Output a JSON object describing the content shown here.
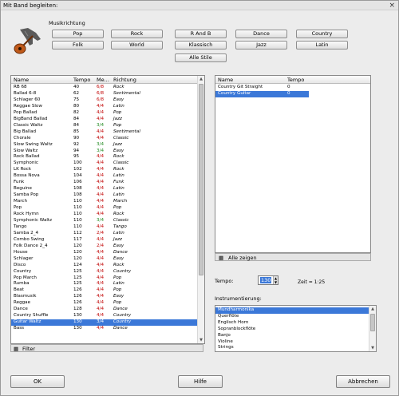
{
  "window": {
    "title": "Mit Band begleiten:",
    "close": "×"
  },
  "styles": {
    "group_label": "Musikrichtung",
    "buttons": [
      "Pop",
      "Rock",
      "R And B",
      "Dance",
      "Country",
      "Folk",
      "World",
      "Klassisch",
      "Jazz",
      "Latin",
      "Alle Stile"
    ]
  },
  "left_table": {
    "headers": [
      "Name",
      "Tempo",
      "Me...",
      "Richtung"
    ],
    "rows": [
      [
        "RB 68",
        "40",
        "6/8",
        "Rock"
      ],
      [
        "Ballad 6-8",
        "62",
        "6/8",
        "Sentimental"
      ],
      [
        "Schlager 60",
        "75",
        "6/8",
        "Easy"
      ],
      [
        "Reggae Slow",
        "80",
        "4/4",
        "Latin"
      ],
      [
        "Pop Ballad",
        "82",
        "4/4",
        "Pop"
      ],
      [
        "BigBand Ballad",
        "84",
        "4/4",
        "Jazz"
      ],
      [
        "Classic Waltz",
        "84",
        "3/4",
        "Pop"
      ],
      [
        "Big Ballad",
        "85",
        "4/4",
        "Sentimental"
      ],
      [
        "Chorale",
        "90",
        "4/4",
        "Classic"
      ],
      [
        "Slow Swing Waltz",
        "92",
        "3/4",
        "Jazz"
      ],
      [
        "Slow Waltz",
        "94",
        "3/4",
        "Easy"
      ],
      [
        "Rock Ballad",
        "95",
        "4/4",
        "Rock"
      ],
      [
        "Symphonic",
        "100",
        "4/4",
        "Classic"
      ],
      [
        "LK Rock",
        "102",
        "4/4",
        "Rock"
      ],
      [
        "Bossa Nova",
        "104",
        "4/4",
        "Latin"
      ],
      [
        "Funk",
        "106",
        "4/4",
        "Funk"
      ],
      [
        "Beguine",
        "108",
        "4/4",
        "Latin"
      ],
      [
        "Samba Pop",
        "108",
        "4/4",
        "Latin"
      ],
      [
        "March",
        "110",
        "4/4",
        "March"
      ],
      [
        "Pop",
        "110",
        "4/4",
        "Pop"
      ],
      [
        "Rock Hymn",
        "110",
        "4/4",
        "Rock"
      ],
      [
        "Symphonic Waltz",
        "110",
        "3/4",
        "Classic"
      ],
      [
        "Tango",
        "110",
        "4/4",
        "Tango"
      ],
      [
        "Samba 2_4",
        "112",
        "2/4",
        "Latin"
      ],
      [
        "Combo Swing",
        "117",
        "4/4",
        "Jazz"
      ],
      [
        "Folk Dance 2_4",
        "120",
        "2/4",
        "Easy"
      ],
      [
        "House",
        "120",
        "4/4",
        "Dance"
      ],
      [
        "Schlager",
        "120",
        "4/4",
        "Easy"
      ],
      [
        "Disco",
        "124",
        "4/4",
        "Rock"
      ],
      [
        "Country",
        "125",
        "4/4",
        "Country"
      ],
      [
        "Pop March",
        "125",
        "4/4",
        "Pop"
      ],
      [
        "Rumba",
        "125",
        "4/4",
        "Latin"
      ],
      [
        "Beat",
        "126",
        "4/4",
        "Pop"
      ],
      [
        "Blasmusik",
        "126",
        "4/4",
        "Easy"
      ],
      [
        "Reggae",
        "126",
        "4/4",
        "Pop"
      ],
      [
        "Dance",
        "128",
        "4/4",
        "Dance"
      ],
      [
        "Country Shuffle",
        "130",
        "4/4",
        "Country"
      ],
      [
        "Guitar Waltz",
        "130",
        "3/4",
        "Country"
      ],
      [
        "Bass",
        "130",
        "4/4",
        "Dance"
      ]
    ],
    "selected_index": 37,
    "footer": "Filter"
  },
  "right_table": {
    "headers": [
      "Name",
      "Tempo"
    ],
    "rows": [
      [
        "Country Git Straight",
        "0"
      ],
      [
        "Country Guitar",
        "0"
      ]
    ],
    "selected_index": 1,
    "footer": "Alle zeigen"
  },
  "tempo": {
    "label": "Tempo:",
    "value": "130",
    "time": "Zeit = 1:25"
  },
  "instruments": {
    "label": "Instrumentierung:",
    "items": [
      "Mundharmonika",
      "Querflöte",
      "Englisch Horn",
      "Sopranblockflöte",
      "Banjo",
      "Violine",
      "Strings"
    ],
    "selected_index": 0
  },
  "buttons": {
    "ok": "OK",
    "help": "Hilfe",
    "cancel": "Abbrechen"
  },
  "colors": {
    "selection": "#3b78d8",
    "meter_red": "#c00000",
    "meter_green": "#1f8a1f"
  }
}
